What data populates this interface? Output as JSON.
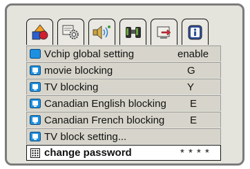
{
  "tabs": [
    {
      "name": "shapes-tab",
      "icon": "shapes-icon"
    },
    {
      "name": "settings-tab",
      "icon": "gear-icon"
    },
    {
      "name": "audio-tab",
      "icon": "speaker-icon"
    },
    {
      "name": "binoculars-tab",
      "icon": "binoculars-icon"
    },
    {
      "name": "input-tab",
      "icon": "input-icon"
    },
    {
      "name": "info-tab",
      "icon": "info-icon"
    }
  ],
  "menu": {
    "items": [
      {
        "label": "Vchip global setting",
        "value": "enable"
      },
      {
        "label": "movie blocking",
        "value": "G"
      },
      {
        "label": "TV blocking",
        "value": "Y"
      },
      {
        "label": "Canadian English blocking",
        "value": "E"
      },
      {
        "label": "Canadian French blocking",
        "value": "E"
      },
      {
        "label": "TV block setting...",
        "value": ""
      },
      {
        "label": "change password",
        "value": "* * * *"
      }
    ]
  },
  "colors": {
    "accent_blue": "#1e90e0",
    "panel_bg": "#e4e3dc",
    "row_bg": "#d7d5cb"
  }
}
